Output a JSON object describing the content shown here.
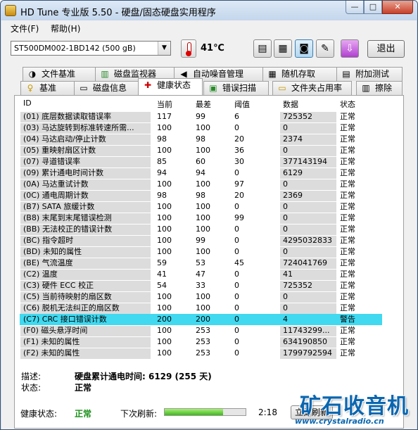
{
  "window": {
    "title": "HD Tune 专业版 5.50 - 硬盘/固态硬盘实用程序"
  },
  "window_buttons": {
    "minimize": "—",
    "maximize": "□",
    "close": "✕"
  },
  "menu": [
    "文件(F)",
    "帮助(H)"
  ],
  "toolbar": {
    "drive": "ST500DM002-1BD142  (500 gB)",
    "temperature": "41℃",
    "exit_label": "退出",
    "buttons": [
      {
        "name": "copy-text-icon",
        "glyph": "▤"
      },
      {
        "name": "copy-info-icon",
        "glyph": "▦"
      },
      {
        "name": "screenshot-camera-icon",
        "glyph": "◙"
      },
      {
        "name": "options-wrench-icon",
        "glyph": "✎"
      },
      {
        "name": "save-download-icon",
        "glyph": "⇩"
      }
    ]
  },
  "tabs_row1": [
    {
      "label": "文件基准",
      "icon": "file-benchmark-icon",
      "glyph": "◑"
    },
    {
      "label": "磁盘监视器",
      "icon": "disk-monitor-icon",
      "glyph": "▥"
    },
    {
      "label": "自动噪音管理",
      "icon": "speaker-icon",
      "glyph": "◀"
    },
    {
      "label": "随机存取",
      "icon": "random-access-icon",
      "glyph": "▦"
    },
    {
      "label": "附加测试",
      "icon": "extra-tests-icon",
      "glyph": "▤"
    }
  ],
  "tabs_row2": [
    {
      "label": "基准",
      "icon": "benchmark-bulb-icon",
      "glyph": "♀"
    },
    {
      "label": "磁盘信息",
      "icon": "disk-info-icon",
      "glyph": "▭"
    },
    {
      "label": "健康状态",
      "icon": "health-cross-icon",
      "glyph": "✚"
    },
    {
      "label": "错误扫描",
      "icon": "error-scan-icon",
      "glyph": "▣"
    },
    {
      "label": "文件夹占用率",
      "icon": "folder-icon",
      "glyph": "▭"
    },
    {
      "label": "擦除",
      "icon": "erase-trash-icon",
      "glyph": "▥"
    }
  ],
  "table": {
    "headers": [
      "ID",
      "当前",
      "最差",
      "阈值",
      "数据",
      "状态"
    ],
    "rows": [
      {
        "id": "(01) 底层数据读取错误率",
        "cur": "117",
        "worst": "99",
        "thr": "6",
        "data": "725352",
        "status": "正常"
      },
      {
        "id": "(03) 马达旋转到标准转速所需...",
        "cur": "100",
        "worst": "100",
        "thr": "0",
        "data": "0",
        "status": "正常"
      },
      {
        "id": "(04) 马达启动/停止计数",
        "cur": "98",
        "worst": "98",
        "thr": "20",
        "data": "2374",
        "status": "正常"
      },
      {
        "id": "(05) 重映射扇区计数",
        "cur": "100",
        "worst": "100",
        "thr": "36",
        "data": "0",
        "status": "正常"
      },
      {
        "id": "(07) 寻道错误率",
        "cur": "85",
        "worst": "60",
        "thr": "30",
        "data": "377143194",
        "status": "正常"
      },
      {
        "id": "(09) 累计通电时间计数",
        "cur": "94",
        "worst": "94",
        "thr": "0",
        "data": "6129",
        "status": "正常"
      },
      {
        "id": "(0A) 马达重试计数",
        "cur": "100",
        "worst": "100",
        "thr": "97",
        "data": "0",
        "status": "正常"
      },
      {
        "id": "(0C) 通电周期计数",
        "cur": "98",
        "worst": "98",
        "thr": "20",
        "data": "2369",
        "status": "正常"
      },
      {
        "id": "(B7) SATA 旅缓计数",
        "cur": "100",
        "worst": "100",
        "thr": "0",
        "data": "0",
        "status": "正常"
      },
      {
        "id": "(B8) 末尾到末尾错误检测",
        "cur": "100",
        "worst": "100",
        "thr": "99",
        "data": "0",
        "status": "正常"
      },
      {
        "id": "(BB) 无法校正的错误计数",
        "cur": "100",
        "worst": "100",
        "thr": "0",
        "data": "0",
        "status": "正常"
      },
      {
        "id": "(BC) 指令超时",
        "cur": "100",
        "worst": "99",
        "thr": "0",
        "data": "4295032833",
        "status": "正常"
      },
      {
        "id": "(BD) 未知的属性",
        "cur": "100",
        "worst": "100",
        "thr": "0",
        "data": "0",
        "status": "正常"
      },
      {
        "id": "(BE) 气流温度",
        "cur": "59",
        "worst": "53",
        "thr": "45",
        "data": "724041769",
        "status": "正常"
      },
      {
        "id": "(C2) 温度",
        "cur": "41",
        "worst": "47",
        "thr": "0",
        "data": "41",
        "status": "正常"
      },
      {
        "id": "(C3) 硬件 ECC 校正",
        "cur": "54",
        "worst": "33",
        "thr": "0",
        "data": "725352",
        "status": "正常"
      },
      {
        "id": "(C5) 当前待映射的扇区数",
        "cur": "100",
        "worst": "100",
        "thr": "0",
        "data": "0",
        "status": "正常"
      },
      {
        "id": "(C6) 脱机无法纠正的扇区数",
        "cur": "100",
        "worst": "100",
        "thr": "0",
        "data": "0",
        "status": "正常"
      },
      {
        "id": "(C7) CRC 接口错误计数",
        "cur": "200",
        "worst": "200",
        "thr": "0",
        "data": "4",
        "status": "警告",
        "selected": true
      },
      {
        "id": "(F0) 磁头悬浮时间",
        "cur": "100",
        "worst": "253",
        "thr": "0",
        "data": "11743299...",
        "status": "正常"
      },
      {
        "id": "(F1) 未知的属性",
        "cur": "100",
        "worst": "253",
        "thr": "0",
        "data": "634190850",
        "status": "正常"
      },
      {
        "id": "(F2) 未知的属性",
        "cur": "100",
        "worst": "253",
        "thr": "0",
        "data": "1799792594",
        "status": "正常"
      }
    ]
  },
  "detail": {
    "desc_label": "描述:",
    "desc_value": "硬盘累计通电时间: 6129  (255 天)",
    "state_label": "状态:",
    "state_value": "正常"
  },
  "statusbar": {
    "health_label": "健康状态:",
    "health_value": "正常",
    "next_refresh_label": "下次刷新:",
    "progress_fraction": 0.72,
    "countdown": "2:18",
    "refresh_button": "立即刷新"
  },
  "watermark": {
    "big": "矿石收音机",
    "small": "www.crystalradio.cn"
  },
  "colors": {
    "selected_row": "#40d9f0",
    "health_ok": "#1a8f1a",
    "watermark": "#0a66b0"
  }
}
